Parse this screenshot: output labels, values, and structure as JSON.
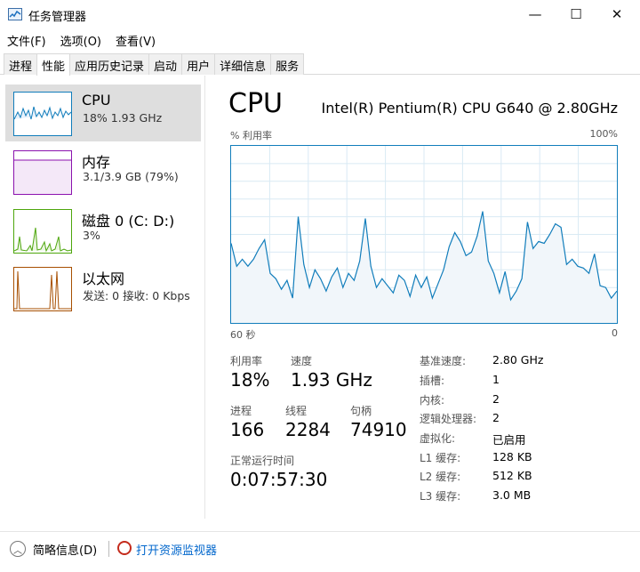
{
  "window": {
    "title": "任务管理器",
    "minimize": "—",
    "maximize": "☐",
    "close": "✕"
  },
  "menu": [
    "文件(F)",
    "选项(O)",
    "查看(V)"
  ],
  "tabs": [
    "进程",
    "性能",
    "应用历史记录",
    "启动",
    "用户",
    "详细信息",
    "服务"
  ],
  "active_tab": "性能",
  "sidebar": {
    "items": [
      {
        "title": "CPU",
        "subtitle": "18% 1.93 GHz",
        "color": "#117dbb",
        "selected": true
      },
      {
        "title": "内存",
        "subtitle": "3.1/3.9 GB (79%)",
        "color": "#8b12ae",
        "selected": false
      },
      {
        "title": "磁盘 0 (C: D:)",
        "subtitle": "3%",
        "color": "#4da60c",
        "selected": false
      },
      {
        "title": "以太网",
        "subtitle": "发送: 0 接收: 0 Kbps",
        "color": "#a74f01",
        "selected": false
      }
    ]
  },
  "main": {
    "title": "CPU",
    "model": "Intel(R) Pentium(R) CPU G640 @ 2.80GHz",
    "graph_label_left": "% 利用率",
    "graph_label_right": "100%",
    "axis_left": "60 秒",
    "axis_right": "0",
    "stats": {
      "utilization_label": "利用率",
      "utilization_value": "18%",
      "speed_label": "速度",
      "speed_value": "1.93 GHz",
      "processes_label": "进程",
      "processes_value": "166",
      "threads_label": "线程",
      "threads_value": "2284",
      "handles_label": "句柄",
      "handles_value": "74910",
      "uptime_label": "正常运行时间",
      "uptime_value": "0:07:57:30"
    },
    "specs": [
      {
        "label": "基准速度:",
        "value": "2.80 GHz"
      },
      {
        "label": "插槽:",
        "value": "1"
      },
      {
        "label": "内核:",
        "value": "2"
      },
      {
        "label": "逻辑处理器:",
        "value": "2"
      },
      {
        "label": "虚拟化:",
        "value": "已启用"
      },
      {
        "label": "L1 缓存:",
        "value": "128 KB"
      },
      {
        "label": "L2 缓存:",
        "value": "512 KB"
      },
      {
        "label": "L3 缓存:",
        "value": "3.0 MB"
      }
    ]
  },
  "footer": {
    "fewer_details": "简略信息(D)",
    "open_resmon": "打开资源监视器"
  },
  "chart_data": {
    "type": "area",
    "ylim": [
      0,
      100
    ],
    "xlim": [
      60,
      0
    ],
    "color": "#117dbb",
    "fill": "#f1f6fa",
    "values": [
      45,
      32,
      36,
      32,
      36,
      42,
      47,
      28,
      25,
      19,
      24,
      14,
      60,
      33,
      20,
      30,
      25,
      18,
      26,
      31,
      20,
      28,
      24,
      35,
      59,
      32,
      20,
      25,
      21,
      17,
      27,
      24,
      15,
      27,
      20,
      26,
      14,
      22,
      30,
      43,
      51,
      46,
      38,
      40,
      49,
      63,
      35,
      28,
      17,
      29,
      13,
      18,
      25,
      57,
      42,
      46,
      45,
      50,
      56,
      54,
      33,
      36,
      32,
      31,
      28,
      39,
      21,
      20,
      14,
      18
    ]
  }
}
